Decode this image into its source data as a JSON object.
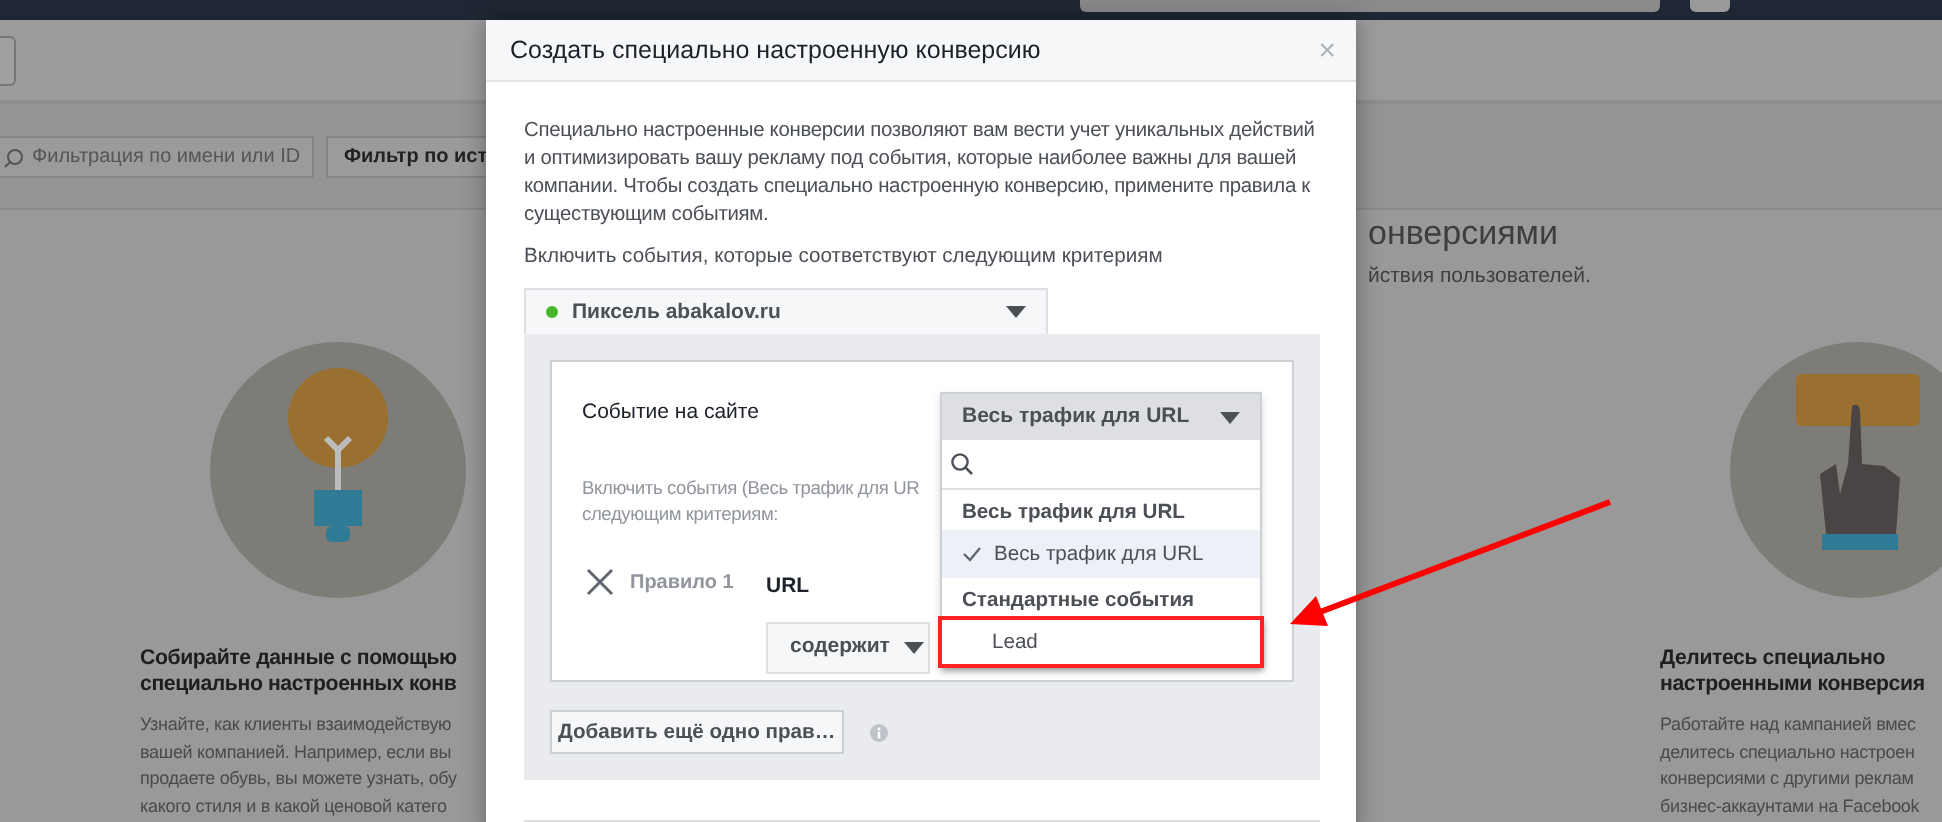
{
  "filter_bar": {
    "search": {
      "placeholder": "Фильтрация по имени или ID"
    },
    "filter_button": "Фильтр по ист"
  },
  "background": {
    "heading": "онверсиями",
    "subtitle": "йствия пользователей.",
    "features": [
      {
        "kind": "bulb",
        "title_lines": [
          "Собирайте данные с помощью",
          "специально настроенных конв"
        ],
        "body_lines": [
          "Узнайте, как клиенты взаимодействую",
          "вашей компанией. Например, если вы",
          "продаете обувь, вы можете узнать, обу",
          "какого стиля и в какой ценовой катего"
        ]
      },
      {
        "kind": "hand",
        "title_lines": [
          "Делитесь специально",
          "настроенными конверсия"
        ],
        "body_lines": [
          "Работайте над кампанией вмес",
          "делитесь специально настроен",
          "конверсиями с другими реклам",
          "бизнес-аккаунтами на Facebook"
        ]
      }
    ]
  },
  "modal": {
    "title": "Создать специально настроенную конверсию",
    "close": "×",
    "intro": "Специально настроенные конверсии позволяют вам вести учет уникальных действий и оптимизировать вашу рекламу под события, которые наиболее важны для вашей компании. Чтобы создать специально настроенную конверсию, примените правила к существующим событиям.",
    "criteria_label": "Включить события, которые соответствуют следующим критериям",
    "pixel": {
      "name": "Пиксель abakalov.ru",
      "active": true
    },
    "event_label": "Событие на сайте",
    "include_hint_lines": [
      "Включить события (Весь трафик для UR",
      "следующим критериям:"
    ],
    "rule": {
      "label": "Правило 1",
      "field": "URL",
      "operator": "содержит"
    },
    "event_select": {
      "value": "Весь трафик для URL",
      "expanded": true,
      "items": [
        {
          "kind": "group",
          "label": "Весь трафик для URL"
        },
        {
          "kind": "option",
          "label": "Весь трафик для URL",
          "selected": true,
          "highlighted": false
        },
        {
          "kind": "group",
          "label": "Стандартные события"
        },
        {
          "kind": "option",
          "label": "Lead",
          "selected": false,
          "highlighted": true
        }
      ]
    },
    "add_rule_button": "Добавить ещё одно прав…"
  }
}
